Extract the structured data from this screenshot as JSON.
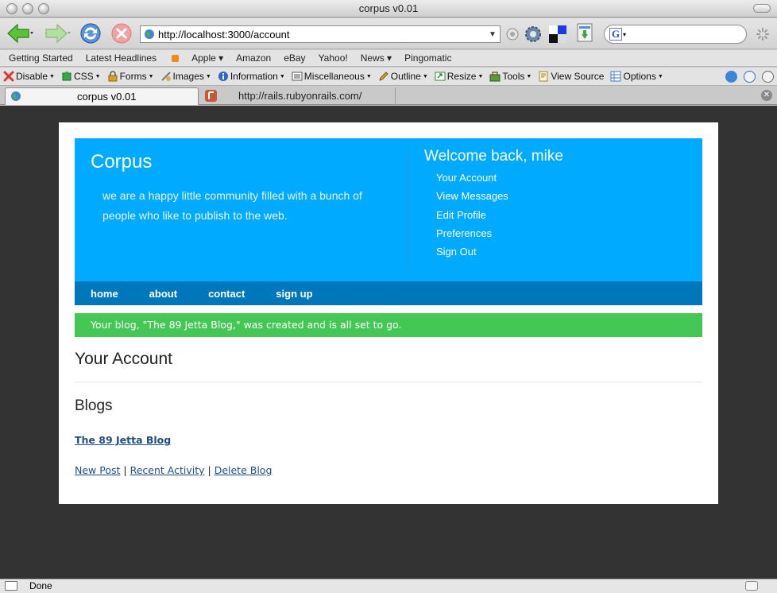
{
  "window": {
    "title": "corpus v0.01"
  },
  "nav": {
    "url": "http://localhost:3000/account"
  },
  "bookmarks": [
    {
      "label": "Getting Started",
      "icon": ""
    },
    {
      "label": "Latest Headlines",
      "icon": "rss-icon"
    },
    {
      "label": "Apple ▾",
      "icon": ""
    },
    {
      "label": "Amazon",
      "icon": ""
    },
    {
      "label": "eBay",
      "icon": ""
    },
    {
      "label": "Yahoo!",
      "icon": ""
    },
    {
      "label": "News ▾",
      "icon": ""
    },
    {
      "label": "Pingomatic",
      "icon": ""
    }
  ],
  "devtoolbar": {
    "items": [
      {
        "label": "Disable",
        "color": "#d93a2b"
      },
      {
        "label": "CSS",
        "color": "#3aa64a"
      },
      {
        "label": "Forms",
        "color": "#d8a21e"
      },
      {
        "label": "Images",
        "color": "#7a7a7a"
      },
      {
        "label": "Information",
        "color": "#2f66c8"
      },
      {
        "label": "Miscellaneous",
        "color": "#555555"
      },
      {
        "label": "Outline",
        "color": "#d8b21e"
      },
      {
        "label": "Resize",
        "color": "#2e8a3b"
      },
      {
        "label": "Tools",
        "color": "#b58a2a"
      },
      {
        "label": "View Source",
        "color": "#c8a84a"
      },
      {
        "label": "Options",
        "color": "#4a7ab8"
      }
    ]
  },
  "tabs": [
    {
      "label": "corpus v0.01"
    },
    {
      "label": "http://rails.rubyonrails.com/"
    }
  ],
  "site": {
    "brand": "Corpus",
    "tagline": "we are a happy little community filled with a bunch of people who like to publish to the web.",
    "welcome": "Welcome back, mike",
    "user_nav": [
      "Your Account",
      "View Messages",
      "Edit Profile",
      "Preferences",
      "Sign Out"
    ],
    "main_nav": [
      "home",
      "about",
      "contact",
      "sign up"
    ],
    "flash": "Your blog, \"The 89 Jetta Blog,\" was created and is all set to go.",
    "page_title": "Your Account",
    "section_title": "Blogs",
    "blog_link": "The 89 Jetta Blog",
    "actions": {
      "new_post": "New Post",
      "recent": "Recent Activity",
      "delete": "Delete Blog",
      "sep": "|"
    }
  },
  "status": {
    "text": "Done"
  },
  "colors": {
    "header_bg": "#00aaff",
    "nav_bg": "#0077bb",
    "flash_bg": "#44c755",
    "viewport_bg": "#333333",
    "link": "#1f4e84"
  }
}
